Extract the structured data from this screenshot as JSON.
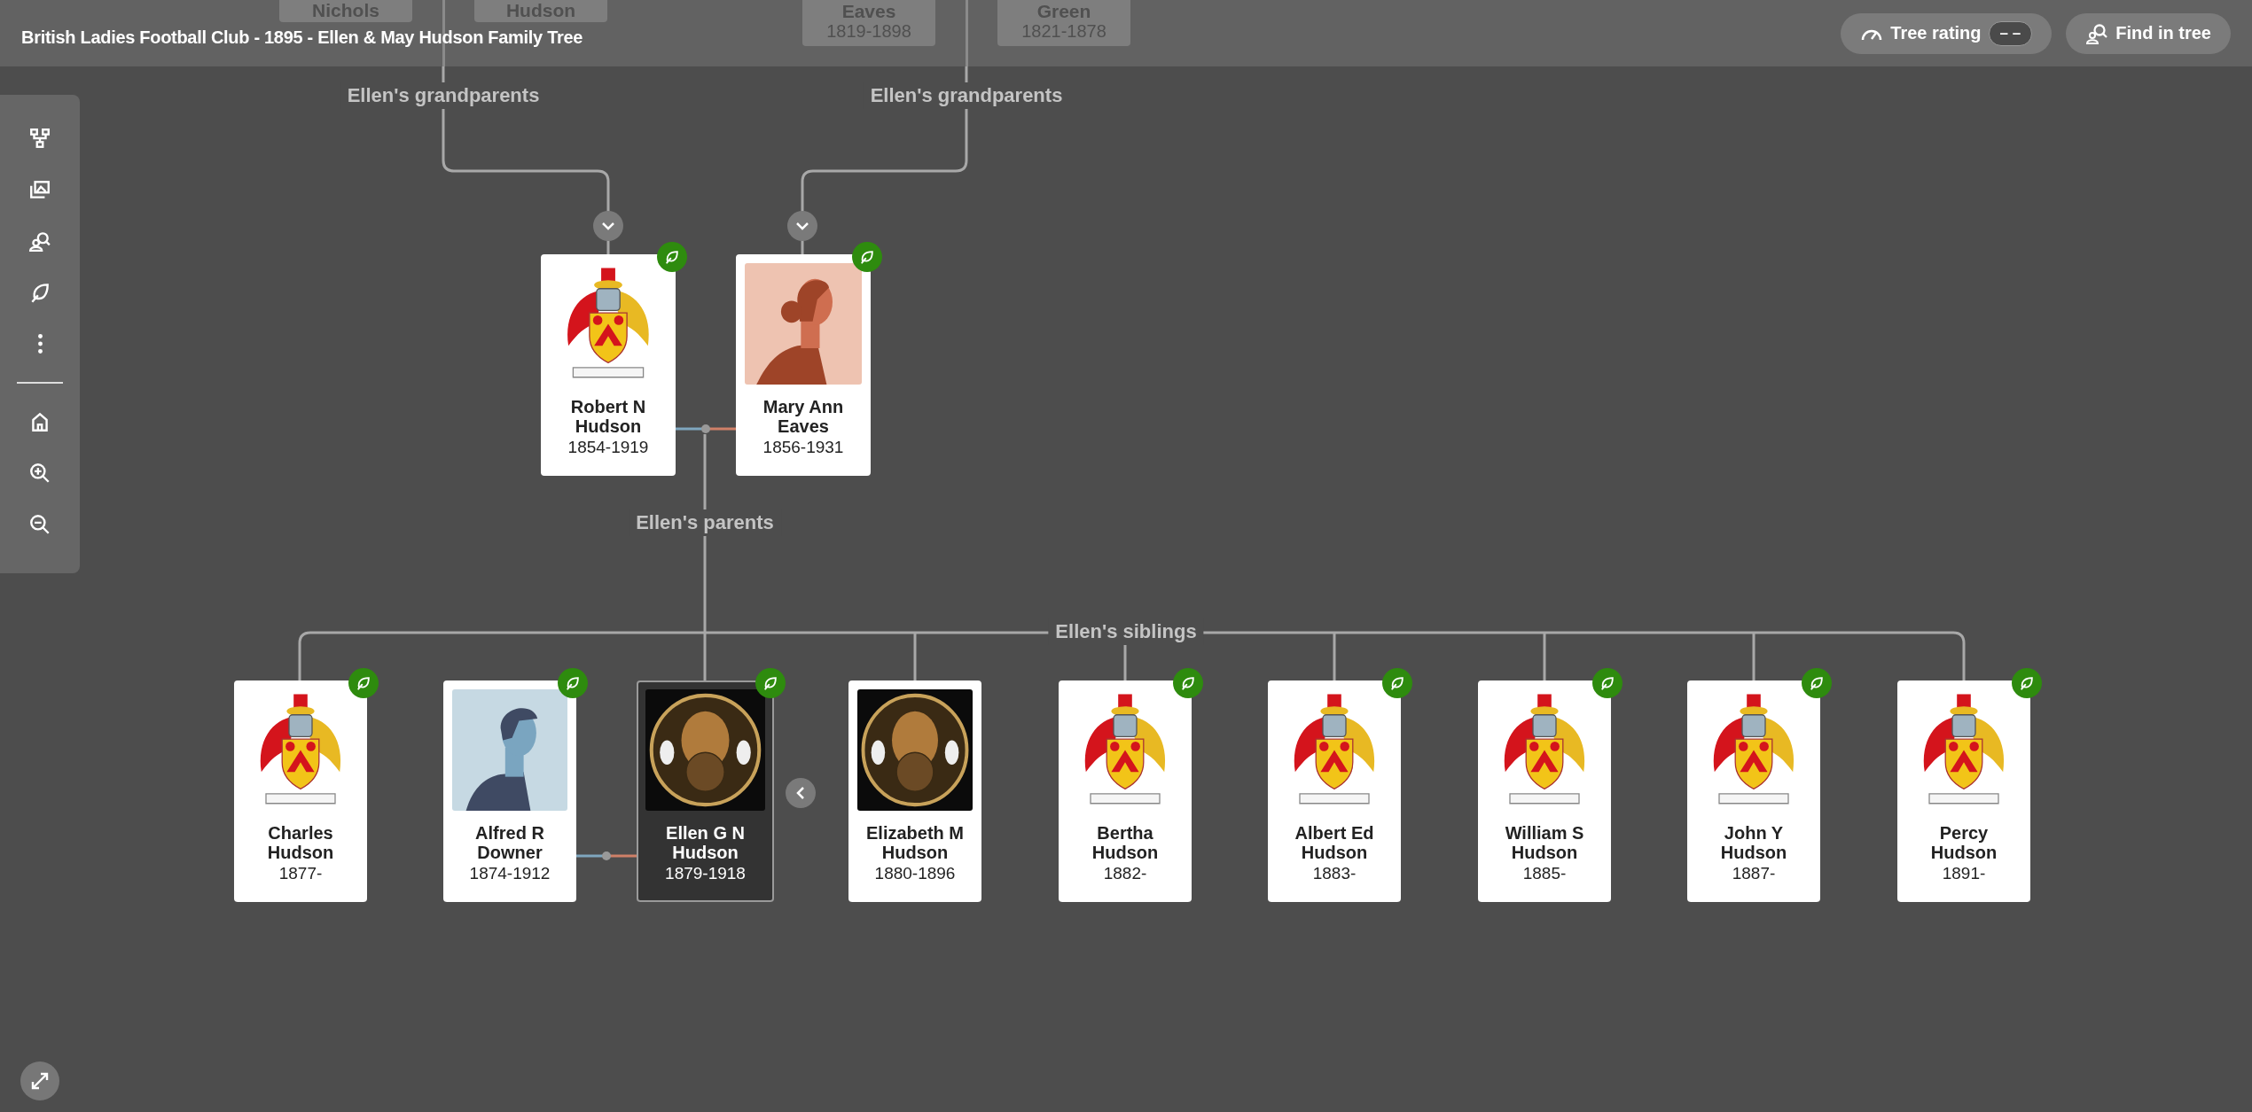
{
  "header": {
    "title": "British Ladies Football Club - 1895 - Ellen & May Hudson Family Tree",
    "tree_rating": {
      "label": "Tree rating",
      "value": "– –"
    },
    "find_button": "Find in tree"
  },
  "ghost_cards": [
    {
      "name": "Nichols"
    },
    {
      "name": "Hudson"
    },
    {
      "name": "Eaves",
      "dates": "1819-1898"
    },
    {
      "name": "Green",
      "dates": "1821-1878"
    }
  ],
  "labels": {
    "paternal_grandparents": "Ellen's grandparents",
    "maternal_grandparents": "Ellen's grandparents",
    "parents": "Ellen's parents",
    "siblings": "Ellen's siblings"
  },
  "parents": [
    {
      "name": "Robert N Hudson",
      "dates": "1854-1919",
      "photo": {
        "kind": "crest"
      },
      "hint": true,
      "selected": false
    },
    {
      "name": "Mary Ann Eaves",
      "dates": "1856-1931",
      "photo": {
        "kind": "female"
      },
      "hint": true,
      "selected": false
    }
  ],
  "bottom_row": [
    {
      "kind": "sibling",
      "name": "Charles Hudson",
      "dates": "1877-",
      "photo": {
        "kind": "crest"
      },
      "hint": true,
      "selected": false
    },
    {
      "kind": "spouse",
      "name": "Alfred R Downer",
      "dates": "1874-1912",
      "photo": {
        "kind": "male"
      },
      "hint": true,
      "selected": false
    },
    {
      "kind": "sibling",
      "name": "Ellen G N Hudson",
      "dates": "1879-1918",
      "photo": {
        "kind": "badge"
      },
      "hint": true,
      "selected": true
    },
    {
      "kind": "sibling",
      "name": "Elizabeth M Hudson",
      "dates": "1880-1896",
      "photo": {
        "kind": "badge"
      },
      "hint": false,
      "selected": false
    },
    {
      "kind": "sibling",
      "name": "Bertha Hudson",
      "dates": "1882-",
      "photo": {
        "kind": "crest"
      },
      "hint": true,
      "selected": false
    },
    {
      "kind": "sibling",
      "name": "Albert Ed Hudson",
      "dates": "1883-",
      "photo": {
        "kind": "crest"
      },
      "hint": true,
      "selected": false
    },
    {
      "kind": "sibling",
      "name": "William S Hudson",
      "dates": "1885-",
      "photo": {
        "kind": "crest"
      },
      "hint": true,
      "selected": false
    },
    {
      "kind": "sibling",
      "name": "John Y Hudson",
      "dates": "1887-",
      "photo": {
        "kind": "crest"
      },
      "hint": true,
      "selected": false
    },
    {
      "kind": "sibling",
      "name": "Percy Hudson",
      "dates": "1891-",
      "photo": {
        "kind": "crest"
      },
      "hint": true,
      "selected": false
    }
  ]
}
